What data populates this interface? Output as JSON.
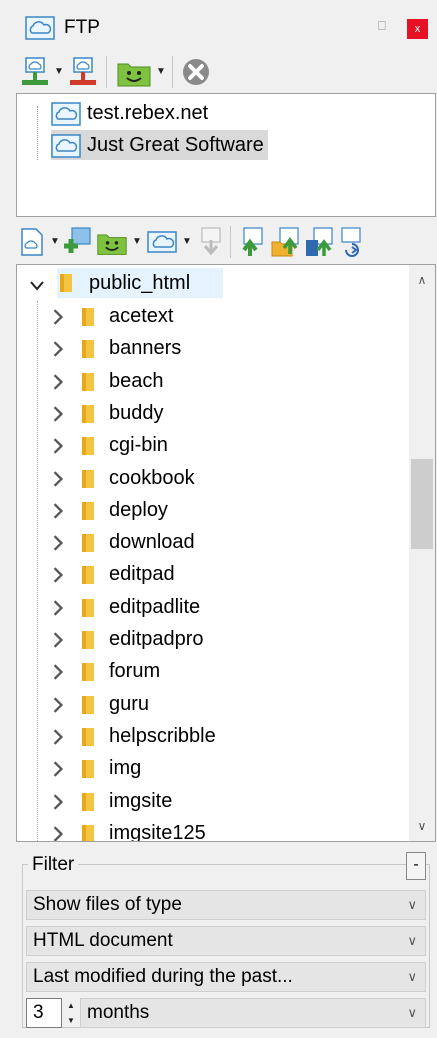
{
  "panel": {
    "title": "FTP",
    "pin_glyph": "⎕",
    "close_glyph": "x"
  },
  "toolbar1": {
    "icons": [
      "connect-icon",
      "disconnect-icon",
      "smiley-icon",
      "stop-icon"
    ]
  },
  "ftp_sites": [
    {
      "label": "test.rebex.net",
      "selected": false
    },
    {
      "label": "Just Great Software",
      "selected": true
    }
  ],
  "toolbar2": {
    "icons": [
      "new-file-icon",
      "new-folder-icon",
      "smiley-icon",
      "cloud-icon",
      "download-icon",
      "upload-icon",
      "upload-folder-icon",
      "upload-all-icon",
      "sync-icon"
    ]
  },
  "tree": {
    "root": "public_html",
    "folders": [
      "acetext",
      "banners",
      "beach",
      "buddy",
      "cgi-bin",
      "cookbook",
      "deploy",
      "download",
      "editpad",
      "editpadlite",
      "editpadpro",
      "forum",
      "guru",
      "helpscribble",
      "img",
      "imgsite",
      "imgsite125"
    ]
  },
  "filter": {
    "title": "Filter",
    "collapse_label": "-",
    "file_type_mode": "Show files of type",
    "file_type": "HTML document",
    "date_mode": "Last modified during the past...",
    "period_value": "3",
    "period_unit": "months",
    "dropdown_glyph": "∨"
  }
}
